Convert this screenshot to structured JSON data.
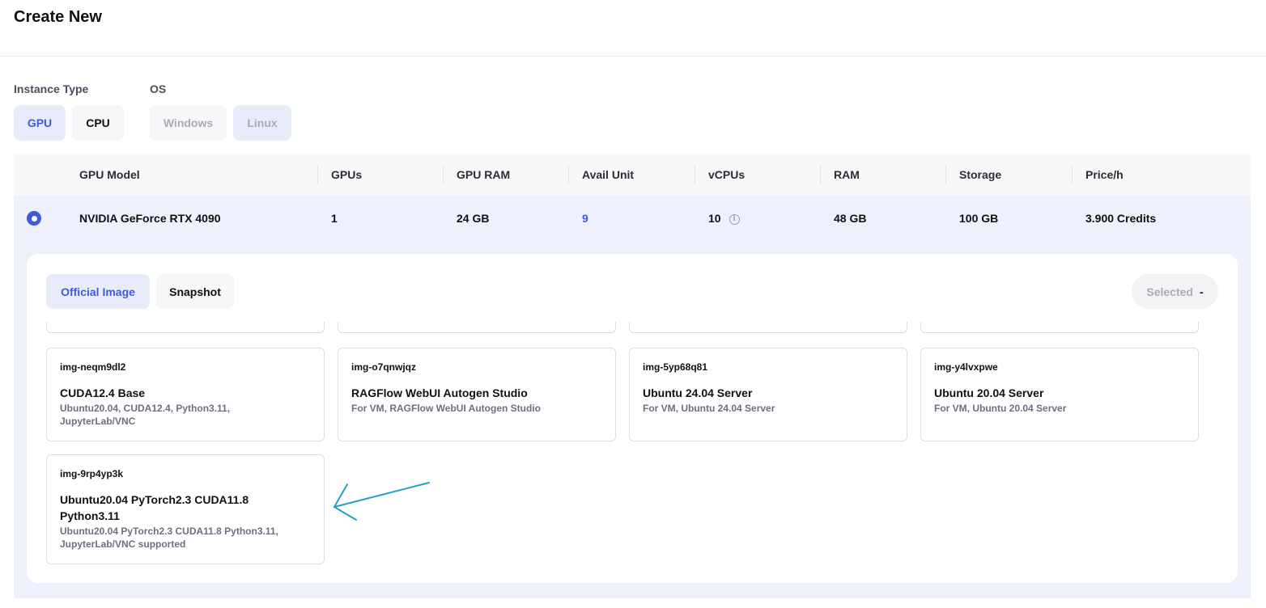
{
  "header": {
    "title": "Create New"
  },
  "filters": {
    "instance_type": {
      "label": "Instance Type",
      "options": [
        "GPU",
        "CPU"
      ],
      "selected": "GPU"
    },
    "os": {
      "label": "OS",
      "options": [
        "Windows",
        "Linux"
      ],
      "selected": "Linux"
    }
  },
  "table": {
    "columns": [
      "GPU Model",
      "GPUs",
      "GPU RAM",
      "Avail Unit",
      "vCPUs",
      "RAM",
      "Storage",
      "Price/h"
    ],
    "row": {
      "gpu_model": "NVIDIA GeForce RTX 4090",
      "gpus": "1",
      "gpu_ram": "24 GB",
      "avail_unit": "9",
      "vcpus": "10",
      "ram": "48 GB",
      "storage": "100 GB",
      "price": "3.900 Credits"
    }
  },
  "images_panel": {
    "tabs": [
      "Official Image",
      "Snapshot"
    ],
    "active_tab": "Official Image",
    "selected_label": "Selected",
    "selected_value": "-",
    "cards": [
      {
        "id": "img-neqm9dl2",
        "title": "CUDA12.4 Base",
        "desc": "Ubuntu20.04, CUDA12.4, Python3.11, JupyterLab/VNC"
      },
      {
        "id": "img-o7qnwjqz",
        "title": "RAGFlow WebUI Autogen Studio",
        "desc": "For VM, RAGFlow WebUI Autogen Studio"
      },
      {
        "id": "img-5yp68q81",
        "title": "Ubuntu 24.04 Server",
        "desc": "For VM, Ubuntu 24.04 Server"
      },
      {
        "id": "img-y4lvxpwe",
        "title": "Ubuntu 20.04 Server",
        "desc": "For VM, Ubuntu 20.04 Server"
      },
      {
        "id": "img-9rp4yp3k",
        "title": "Ubuntu20.04 PyTorch2.3 CUDA11.8 Python3.11",
        "desc": "Ubuntu20.04 PyTorch2.3 CUDA11.8 Python3.11, JupyterLab/VNC supported"
      }
    ]
  },
  "colors": {
    "accent": "#3e5bd8",
    "selected_bg": "#e8ebfa",
    "annotation_arrow": "#2a9fc2"
  },
  "icons": {
    "radio": "radio-selected-icon",
    "info": "info-icon",
    "arrow": "annotation-arrow-icon"
  }
}
